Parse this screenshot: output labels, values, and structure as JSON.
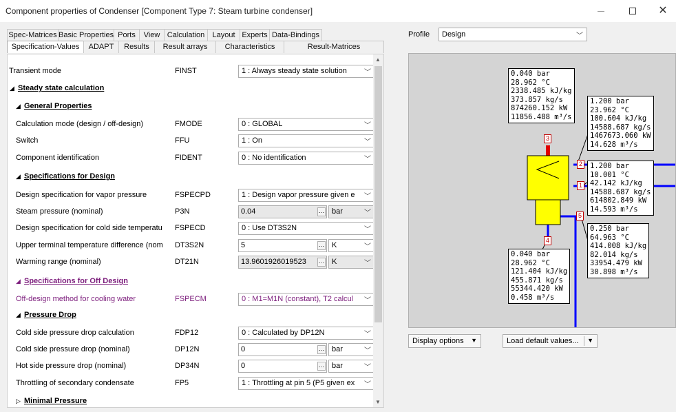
{
  "window": {
    "title": "Component properties of Condenser   [Component Type 7: Steam turbine condenser]",
    "minimize_glyph": "—",
    "close_glyph": "✕"
  },
  "tabs_row1": [
    "Spec-Matrices",
    "Basic Properties",
    "Ports",
    "View",
    "Calculation",
    "Layout",
    "Experts",
    "Data-Bindings"
  ],
  "tabs_row2": [
    "Specification-Values",
    "ADAPT",
    "Results",
    "Result arrays",
    "Characteristics",
    "Result-Matrices"
  ],
  "active_tab": "Specification-Values",
  "properties": {
    "transient": {
      "label": "Transient mode",
      "code": "FINST",
      "value": "1 : Always steady state solution"
    },
    "h_steady": "Steady state calculation",
    "h_general": "General Properties",
    "fmode": {
      "label": "Calculation mode (design / off-design)",
      "code": "FMODE",
      "value": "0 : GLOBAL"
    },
    "ffu": {
      "label": "Switch",
      "code": "FFU",
      "value": "1 : On"
    },
    "fident": {
      "label": "Component identification",
      "code": "FIDENT",
      "value": "0 : No identification"
    },
    "h_design": "Specifications for Design",
    "fspecpd": {
      "label": "Design specification for vapor pressure",
      "code": "FSPECPD",
      "value": "1 : Design vapor pressure given e"
    },
    "p3n": {
      "label": "Steam pressure (nominal)",
      "code": "P3N",
      "value": "0.04",
      "unit": "bar"
    },
    "fspecd": {
      "label": "Design specification for cold side temperatu",
      "code": "FSPECD",
      "value": "0 : Use DT3S2N"
    },
    "dt3s2n": {
      "label": "Upper terminal temperature difference (nom",
      "code": "DT3S2N",
      "value": "5",
      "unit": "K"
    },
    "dt21n": {
      "label": "Warming range (nominal)",
      "code": "DT21N",
      "value": "13.9601926019523",
      "unit": "K"
    },
    "h_offdesign": "Specifications for Off Design",
    "fspecm": {
      "label": "Off-design method for cooling water",
      "code": "FSPECM",
      "value": "0 : M1=M1N (constant), T2 calcul"
    },
    "h_pressure": "Pressure Drop",
    "fdp12": {
      "label": "Cold side pressure drop calculation",
      "code": "FDP12",
      "value": "0 : Calculated by DP12N"
    },
    "dp12n": {
      "label": "Cold side pressure drop (nominal)",
      "code": "DP12N",
      "value": "0",
      "unit": "bar"
    },
    "dp34n": {
      "label": "Hot side pressure drop (nominal)",
      "code": "DP34N",
      "value": "0",
      "unit": "bar"
    },
    "fp5": {
      "label": "Throttling of secondary condensate",
      "code": "FP5",
      "value": "1 : Throttling at pin 5 (P5 given ex"
    },
    "h_minimal": "Minimal Pressure"
  },
  "profile": {
    "label": "Profile",
    "value": "Design"
  },
  "diagram": {
    "pins": [
      "3",
      "2",
      "1",
      "5",
      "4"
    ],
    "box_pin3": [
      "0.040 bar",
      "28.962 °C",
      "2338.485 kJ/kg",
      "373.857 kg/s",
      "874260.152 kW",
      "11856.488 m³/s"
    ],
    "box_pin2": [
      "1.200 bar",
      "23.962 °C",
      "100.604 kJ/kg",
      "14588.687 kg/s",
      "1467673.060 kW",
      "14.628 m³/s"
    ],
    "box_pin1": [
      "1.200 bar",
      "10.001 °C",
      "42.142 kJ/kg",
      "14588.687 kg/s",
      "614802.849 kW",
      "14.593 m³/s"
    ],
    "box_pin5": [
      "0.250 bar",
      "64.963 °C",
      "414.008 kJ/kg",
      "82.014 kg/s",
      "33954.479 kW",
      "30.898 m³/s"
    ],
    "box_pin4": [
      "0.040 bar",
      "28.962 °C",
      "121.404 kJ/kg",
      "455.871 kg/s",
      "55344.420 kW",
      "0.458 m³/s"
    ],
    "colors": {
      "condenser": "#ffff00",
      "water_line": "#0000ff",
      "steam_line": "#e00000",
      "pin_border": "#c00000"
    }
  },
  "buttons": {
    "display_options": "Display options",
    "load_defaults": "Load default values..."
  }
}
